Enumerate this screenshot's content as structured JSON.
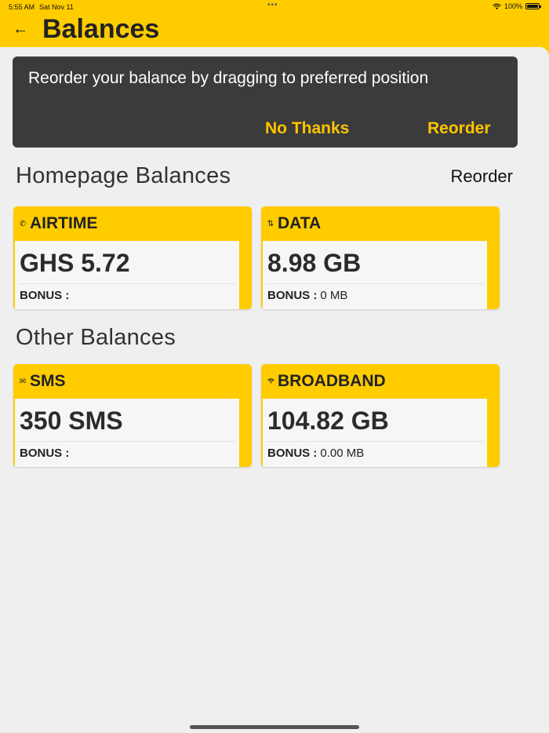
{
  "status": {
    "time": "5:55 AM",
    "date": "Sat Nov 11",
    "battery": "100%"
  },
  "header": {
    "title": "Balances",
    "back_icon": "arrow-left-icon"
  },
  "banner": {
    "message": "Reorder your balance by dragging to preferred position",
    "no_thanks": "No Thanks",
    "reorder": "Reorder"
  },
  "homepage": {
    "title": "Homepage Balances",
    "reorder_link": "Reorder",
    "cards": [
      {
        "icon": "phone-icon",
        "label": "AIRTIME",
        "value": "GHS 5.72",
        "bonus_label": "BONUS :",
        "bonus_value": ""
      },
      {
        "icon": "data-arrows-icon",
        "label": "DATA",
        "value": "8.98 GB",
        "bonus_label": "BONUS :",
        "bonus_value": "0 MB"
      }
    ]
  },
  "other": {
    "title": "Other Balances",
    "cards": [
      {
        "icon": "mail-icon",
        "label": "SMS",
        "value": "350 SMS",
        "bonus_label": "BONUS :",
        "bonus_value": ""
      },
      {
        "icon": "wifi-icon",
        "label": "BROADBAND",
        "value": "104.82 GB",
        "bonus_label": "BONUS :",
        "bonus_value": "0.00 MB"
      }
    ]
  },
  "colors": {
    "brand": "#ffcc00",
    "banner_bg": "#3b3b3b",
    "banner_action": "#ffc400"
  }
}
